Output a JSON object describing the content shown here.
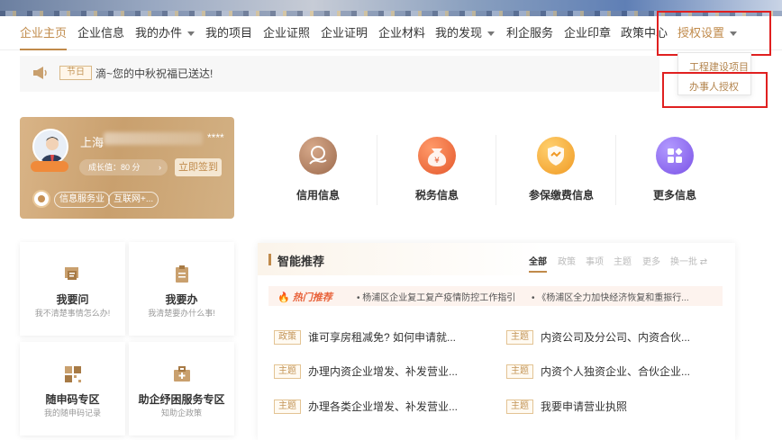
{
  "nav": {
    "items": [
      "企业主页",
      "企业信息",
      "我的办件",
      "我的项目",
      "企业证照",
      "企业证明",
      "企业材料",
      "我的发现",
      "利企服务",
      "企业印章",
      "政策中心",
      "授权设置"
    ],
    "active": "企业主页"
  },
  "dropdown": {
    "items": [
      "工程建设项目",
      "办事人授权"
    ]
  },
  "notice": {
    "tag": "节日",
    "text": "滴~您的中秋祝福已送达!"
  },
  "profile": {
    "name_prefix": "上海",
    "name_suffix": "****",
    "growth": "成长值：80 分",
    "growth_arrow": "›",
    "sign_in": "立即签到",
    "tags": [
      "信息服务业",
      "互联网+..."
    ]
  },
  "services": [
    {
      "label": "信用信息",
      "color": "#b88462"
    },
    {
      "label": "税务信息",
      "color": "#f06a3a"
    },
    {
      "label": "参保缴费信息",
      "color": "#f4a93a"
    },
    {
      "label": "更多信息",
      "color": "#8d6cf0"
    }
  ],
  "quick": [
    {
      "title": "我要问",
      "sub": "我不清楚事情怎么办!"
    },
    {
      "title": "我要办",
      "sub": "我清楚要办什么事!"
    },
    {
      "title": "随申码专区",
      "sub": "我的随申码记录"
    },
    {
      "title": "助企纾困服务专区",
      "sub": "知助企政策"
    }
  ],
  "recommend": {
    "title": "智能推荐",
    "tabs": [
      "全部",
      "政策",
      "事项",
      "主题",
      "更多",
      "换一批 ⇄"
    ],
    "hot_label": "热门推荐",
    "hot_items": [
      "• 杨浦区企业复工复产疫情防控工作指引",
      "• 《杨浦区全力加快经济恢复和重振行..."
    ],
    "rows": [
      {
        "tag": "政策",
        "text": "谁可享房租减免? 如何申请就..."
      },
      {
        "tag": "主题",
        "text": "内资公司及分公司、内资合伙..."
      },
      {
        "tag": "主题",
        "text": "办理内资企业增发、补发营业..."
      },
      {
        "tag": "主题",
        "text": "内资个人独资企业、合伙企业..."
      },
      {
        "tag": "主题",
        "text": "办理各类企业增发、补发营业..."
      },
      {
        "tag": "主题",
        "text": "我要申请营业执照"
      }
    ]
  },
  "colors": {
    "accent": "#c08a4a",
    "highlight_box": "#e02020"
  }
}
